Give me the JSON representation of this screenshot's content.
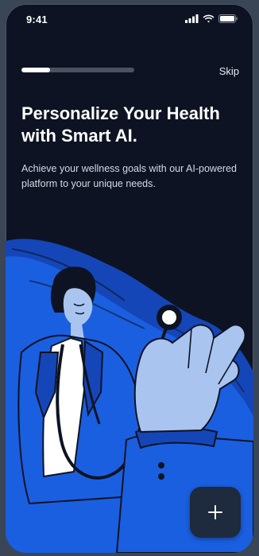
{
  "status_bar": {
    "time": "9:41",
    "icons": [
      "cellular-signal-icon",
      "wifi-icon",
      "battery-icon"
    ]
  },
  "onboarding": {
    "progress": 0.25,
    "skip_label": "Skip",
    "title": "Personalize Your Health with Smart AI.",
    "subtitle": "Achieve your wellness goals with our AI-powered platform to your unique needs.",
    "illustration": "doctor-with-stethoscope-illustration",
    "next_button_icon": "plus-icon"
  },
  "colors": {
    "background": "#0d1322",
    "accent_blue": "#1a5fe0",
    "light_blue": "#a9c4ef",
    "button": "#1e2a3d"
  }
}
